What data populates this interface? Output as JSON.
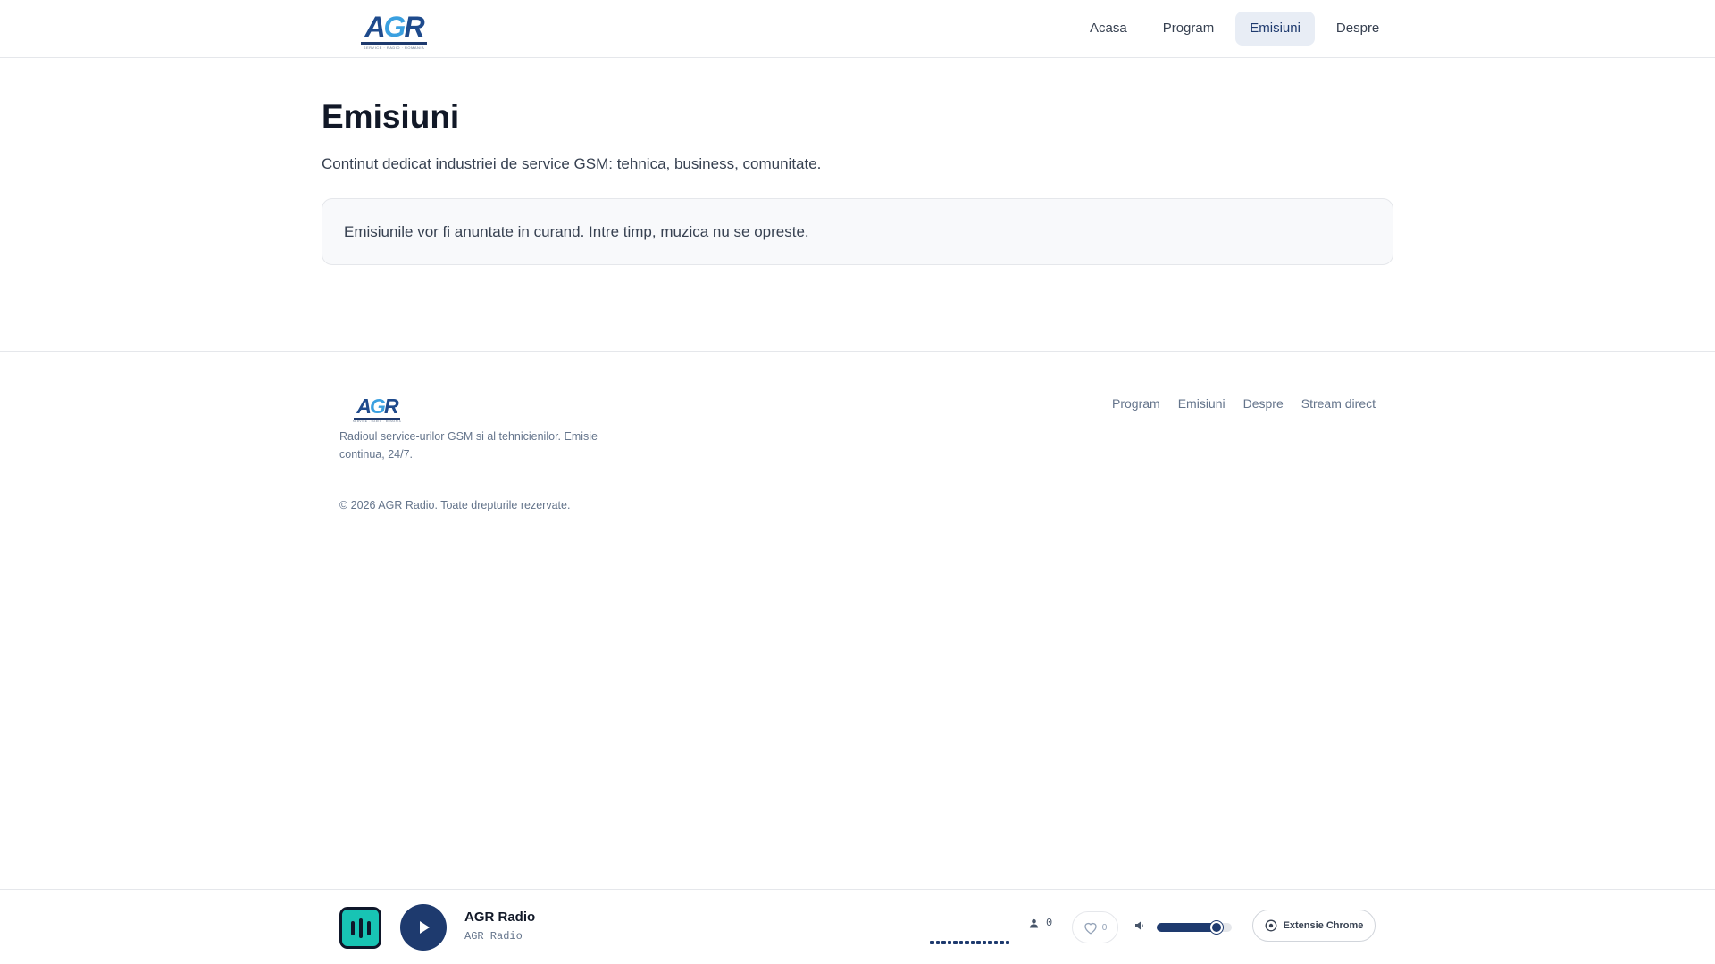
{
  "header": {
    "logo": {
      "mark_a": "A",
      "mark_g": "G",
      "mark_r": "R",
      "sub": "SERVICE · RADIO · ROMANIA"
    },
    "nav": [
      {
        "label": "Acasa",
        "active": false
      },
      {
        "label": "Program",
        "active": false
      },
      {
        "label": "Emisiuni",
        "active": true
      },
      {
        "label": "Despre",
        "active": false
      }
    ]
  },
  "main": {
    "title": "Emisiuni",
    "description": "Continut dedicat industriei de service GSM: tehnica, business, comunitate.",
    "notice": "Emisiunile vor fi anuntate in curand. Intre timp, muzica nu se opreste."
  },
  "footer": {
    "tagline": "Radioul service-urilor GSM si al tehnicienilor. Emisie continua, 24/7.",
    "copyright": "© 2026 AGR Radio. Toate drepturile rezervate.",
    "links": [
      "Program",
      "Emisiuni",
      "Despre",
      "Stream direct"
    ]
  },
  "player": {
    "station_name": "AGR Radio",
    "station_sub": "AGR Radio",
    "listener_count": "0",
    "like_count": "0",
    "volume_percent": 80,
    "extension_label": "Extensie Chrome"
  },
  "colors": {
    "brand": "#1e3a6e",
    "accent": "#18c4b4",
    "nav_active_bg": "#e8edf5"
  },
  "icons": {
    "equalizer": "equalizer-icon",
    "play": "play-icon",
    "listeners": "user-icon",
    "like": "heart-icon",
    "volume": "speaker-icon",
    "extension": "chrome-icon"
  }
}
